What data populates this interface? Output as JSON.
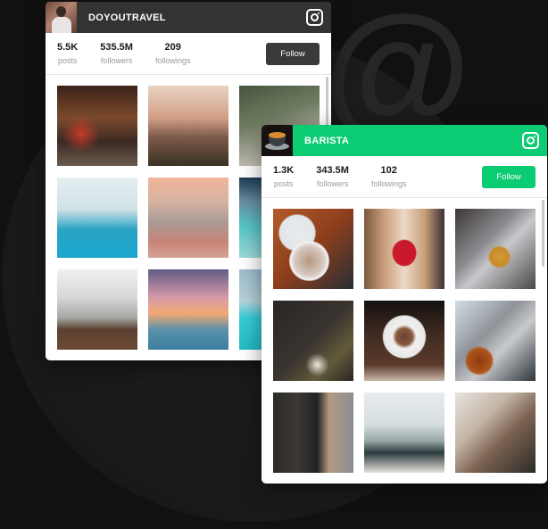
{
  "background": {
    "decoration_glyph": "@",
    "color": "#111111"
  },
  "cards": [
    {
      "username": "DOYOUTRAVEL",
      "header_color": "#333333",
      "avatar_icon": "traveler-avatar",
      "platform_icon": "instagram-icon",
      "stats": [
        {
          "value": "5.5K",
          "label": "posts"
        },
        {
          "value": "535.5M",
          "label": "followers"
        },
        {
          "value": "209",
          "label": "followings"
        }
      ],
      "follow_label": "Follow",
      "follow_color": "#3a3a3a",
      "photos": [
        {
          "subject": "lantern-restaurant"
        },
        {
          "subject": "taipei-sunset"
        },
        {
          "subject": "mountain-portrait"
        },
        {
          "subject": "cave-pool"
        },
        {
          "subject": "city-rooftop"
        },
        {
          "subject": "resort-lagoon"
        },
        {
          "subject": "couple-overlook"
        },
        {
          "subject": "couple-infinity-pool"
        },
        {
          "subject": "turquoise-resort"
        }
      ]
    },
    {
      "username": "BARISTA",
      "header_color": "#0bcb73",
      "avatar_icon": "coffee-cup-avatar",
      "platform_icon": "instagram-icon",
      "stats": [
        {
          "value": "1.3K",
          "label": "posts"
        },
        {
          "value": "343.5M",
          "label": "followers"
        },
        {
          "value": "102",
          "label": "followings"
        }
      ],
      "follow_label": "Follow",
      "follow_color": "#0bcb73",
      "photos": [
        {
          "subject": "latte-art-saucer"
        },
        {
          "subject": "red-cup-sip"
        },
        {
          "subject": "milk-pour"
        },
        {
          "subject": "barista-pouring"
        },
        {
          "subject": "pour-over-filter"
        },
        {
          "subject": "espresso-machine"
        },
        {
          "subject": "woman-with-coffee"
        },
        {
          "subject": "cafe-counter"
        },
        {
          "subject": "barista-apron"
        }
      ]
    }
  ]
}
